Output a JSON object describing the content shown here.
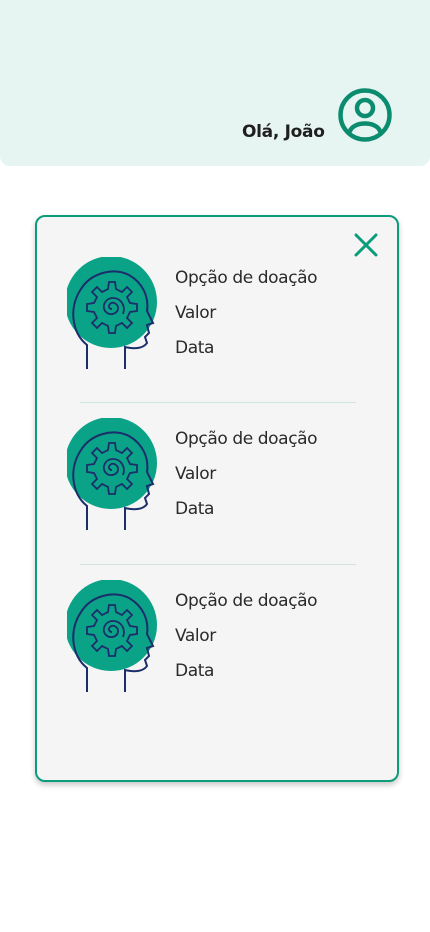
{
  "header": {
    "greeting": "Olá, João",
    "avatar_icon": "user-circle-icon",
    "bg_color": "#e6f5f2"
  },
  "panel": {
    "close_icon": "close-icon",
    "accent_color": "#0c9c7b",
    "items": [
      {
        "option": "Opção de doação",
        "value": "Valor",
        "date": "Data",
        "icon": "head-gear-icon"
      },
      {
        "option": "Opção de doação",
        "value": "Valor",
        "date": "Data",
        "icon": "head-gear-icon"
      },
      {
        "option": "Opção de doação",
        "value": "Valor",
        "date": "Data",
        "icon": "head-gear-icon"
      }
    ]
  }
}
